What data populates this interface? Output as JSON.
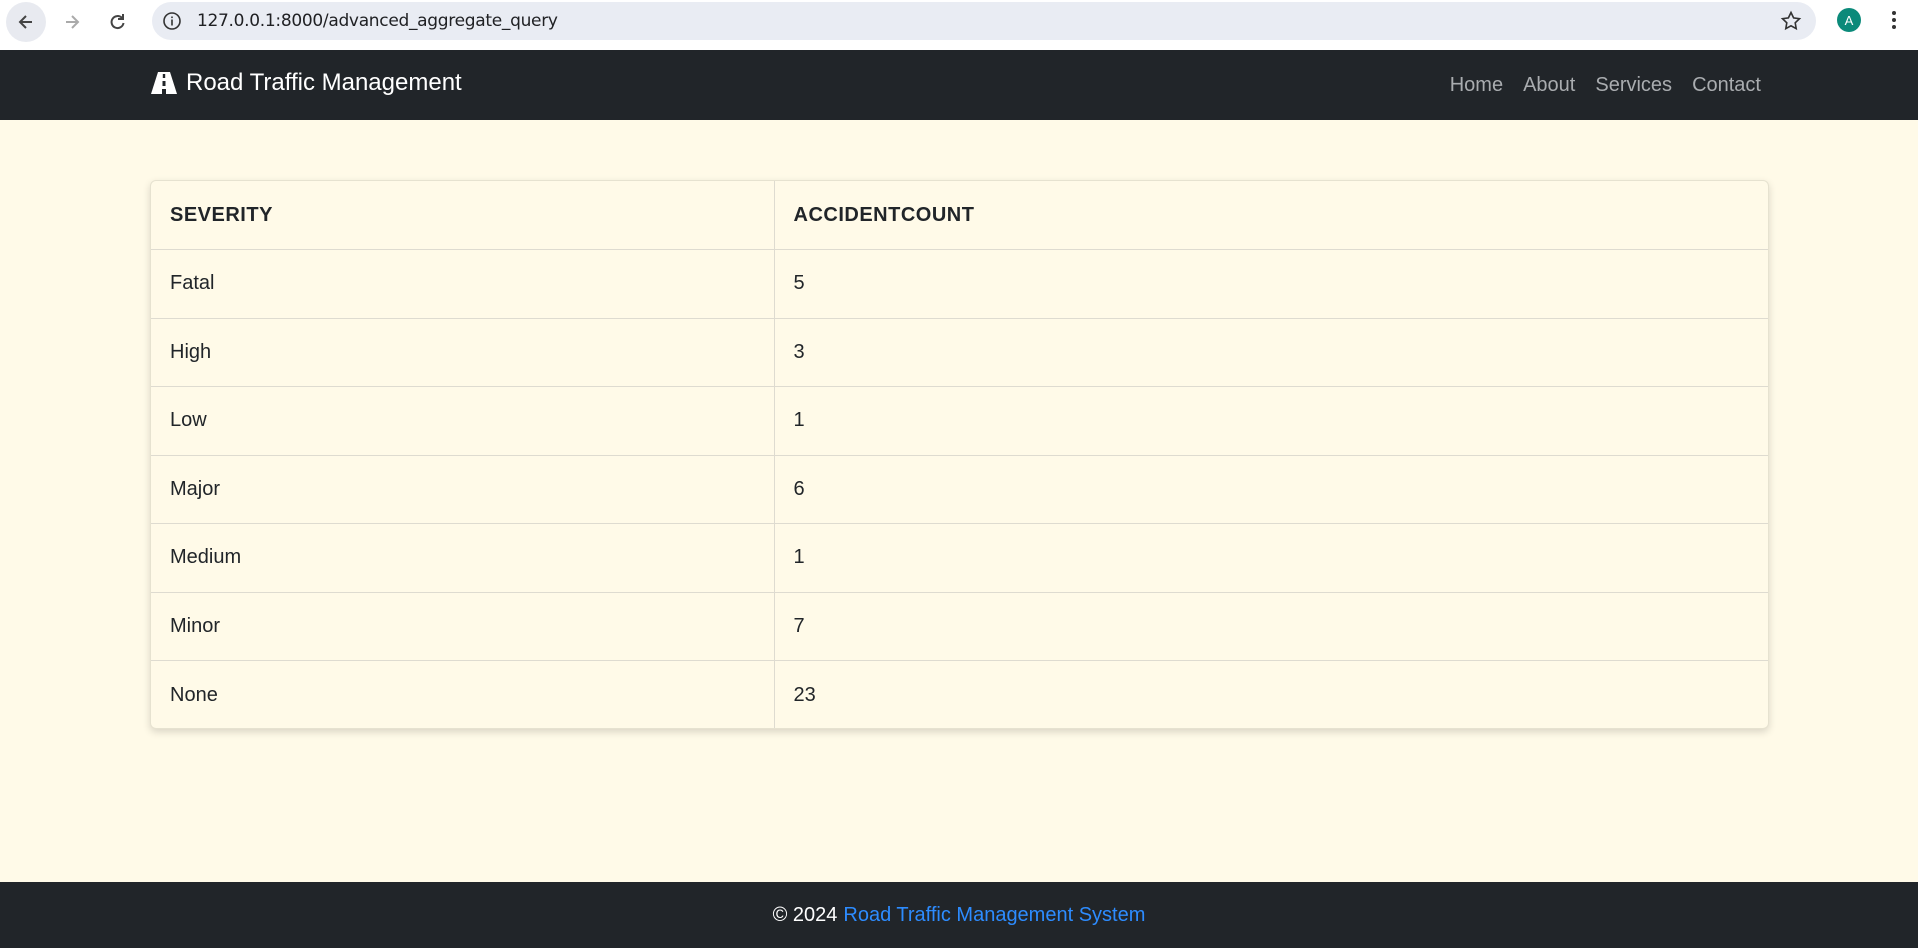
{
  "browser": {
    "url": "127.0.0.1:8000/advanced_aggregate_query",
    "profile_initial": "A"
  },
  "navbar": {
    "brand": "Road Traffic Management",
    "brand_icon": "road-icon",
    "links": [
      "Home",
      "About",
      "Services",
      "Contact"
    ]
  },
  "table": {
    "headers": [
      "SEVERITY",
      "ACCIDENTCOUNT"
    ],
    "rows": [
      {
        "severity": "Fatal",
        "count": "5"
      },
      {
        "severity": "High",
        "count": "3"
      },
      {
        "severity": "Low",
        "count": "1"
      },
      {
        "severity": "Major",
        "count": "6"
      },
      {
        "severity": "Medium",
        "count": "1"
      },
      {
        "severity": "Minor",
        "count": "7"
      },
      {
        "severity": "None",
        "count": "23"
      }
    ]
  },
  "footer": {
    "copyright": "© 2024",
    "link_text": "Road Traffic Management System"
  },
  "colors": {
    "navbar_bg": "#212529",
    "page_bg": "#fffae8",
    "link_blue": "#2d8cff"
  }
}
